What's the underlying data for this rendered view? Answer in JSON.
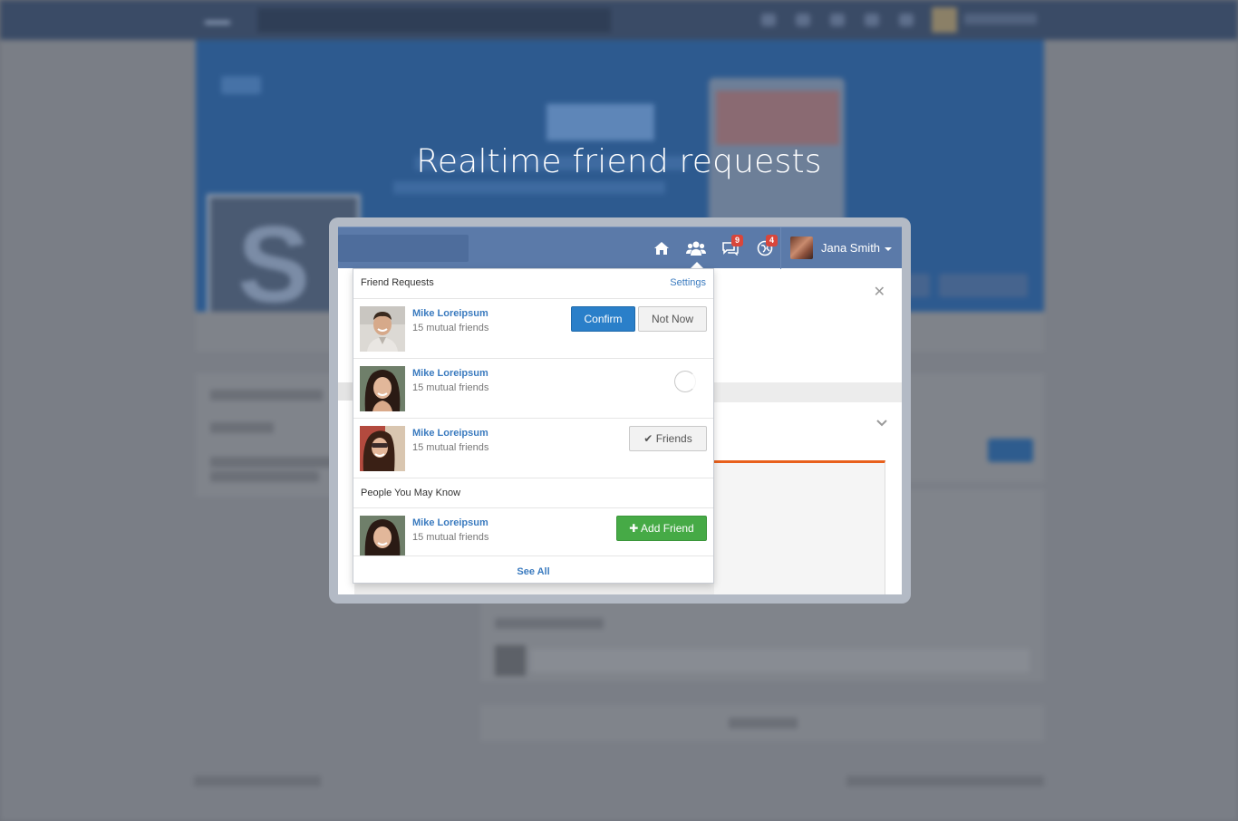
{
  "headline": "Realtime friend requests",
  "navbar": {
    "user_name": "Jana Smith",
    "messages_badge": "9",
    "notifications_badge": "4"
  },
  "friend_requests": {
    "title": "Friend Requests",
    "settings_label": "Settings",
    "items": [
      {
        "name": "Mike Loreipsum",
        "mutual": "15 mutual friends",
        "confirm_label": "Confirm",
        "notnow_label": "Not Now"
      },
      {
        "name": "Mike Loreipsum",
        "mutual": "15 mutual friends"
      },
      {
        "name": "Mike Loreipsum",
        "mutual": "15 mutual friends",
        "friends_label": "Friends"
      }
    ]
  },
  "people_you_may_know": {
    "title": "People You May Know",
    "items": [
      {
        "name": "Mike Loreipsum",
        "mutual": "15 mutual friends",
        "add_label": "Add Friend"
      }
    ]
  },
  "see_all_label": "See All",
  "colors": {
    "navbar": "#5b7aa9",
    "link": "#3b7bbf",
    "confirm": "#2a7fc9",
    "add_friend": "#46aa46",
    "badge": "#d9463b"
  }
}
